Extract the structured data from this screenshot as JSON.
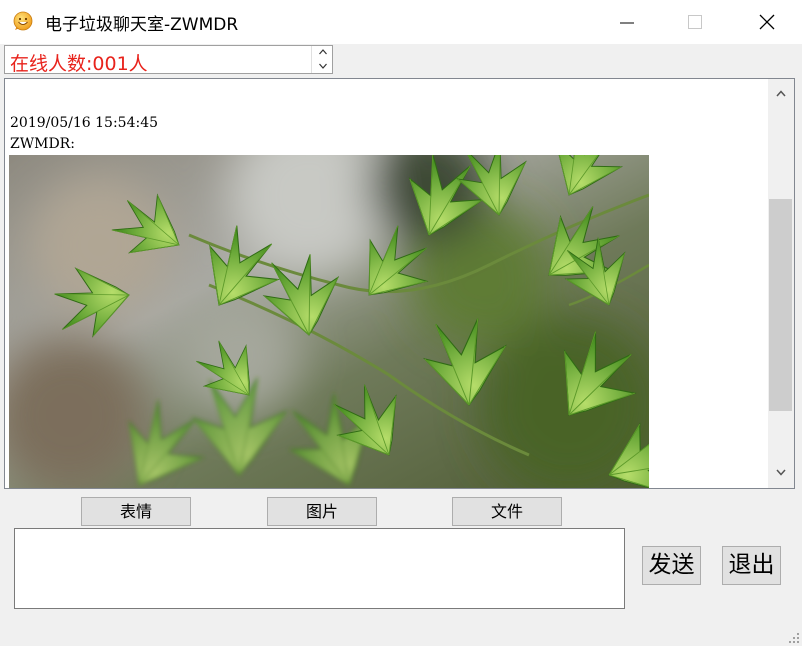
{
  "window": {
    "title": "电子垃圾聊天室-ZWMDR",
    "app_icon": "smiley-chat-icon",
    "controls": [
      "minimize-icon",
      "maximize-icon",
      "close-icon"
    ]
  },
  "online": {
    "text": "在线人数:001人",
    "color": "#e8231c"
  },
  "chat": {
    "messages": [
      {
        "timestamp": "2019/05/16 15:54:45",
        "user": "ZWMDR:",
        "attachment": "photo-green-maple-leaves"
      }
    ]
  },
  "toolbar": {
    "emoji_label": "表情",
    "image_label": "图片",
    "file_label": "文件"
  },
  "compose": {
    "value": ""
  },
  "actions": {
    "send_label": "发送",
    "exit_label": "退出"
  }
}
